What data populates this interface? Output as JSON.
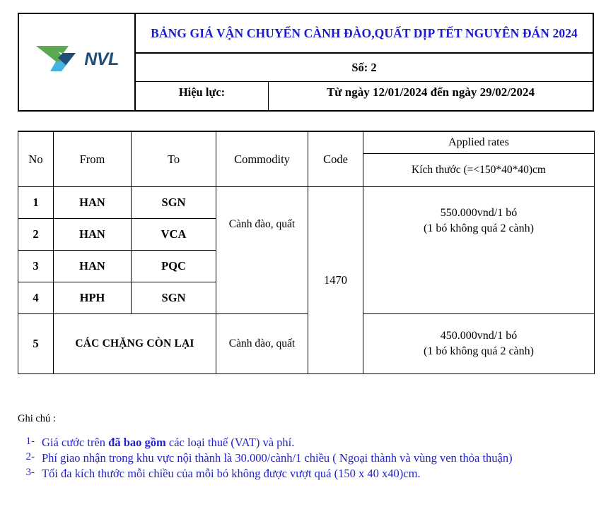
{
  "header": {
    "logo": {
      "icon": "nvl-bird-logo",
      "text": "NVL",
      "colors": {
        "wing_green": "#5aa84f",
        "wing_blue": "#45b3e0",
        "center_navy": "#1f4e79",
        "text": "#1f4e79"
      }
    },
    "title": "BẢNG GIÁ VẬN CHUYỂN CÀNH ĐÀO,QUẤT DỊP TẾT NGUYÊN ĐÁN 2024",
    "title_color": "#1a1ad2",
    "number_label": "Số: 2",
    "effective_label": "Hiệu lực:",
    "effective_value": "Từ ngày 12/01/2024  đến ngày 29/02/2024"
  },
  "table": {
    "columns": {
      "no": "No",
      "from": "From",
      "to": "To",
      "commodity": "Commodity",
      "code": "Code",
      "applied_rates": "Applied rates",
      "size": "Kích thước (=<150*40*40)cm"
    },
    "rows": [
      {
        "no": "1",
        "from": "HAN",
        "to": "SGN"
      },
      {
        "no": "2",
        "from": "HAN",
        "to": "VCA"
      },
      {
        "no": "3",
        "from": "HAN",
        "to": "PQC"
      },
      {
        "no": "4",
        "from": "HPH",
        "to": "SGN"
      }
    ],
    "group_1_4": {
      "commodity": "Cành đào, quất",
      "rate_line1": "550.000vnd/1 bó",
      "rate_line2": "(1 bó không quá 2 cành)"
    },
    "code_all": "1470",
    "row_5": {
      "no": "5",
      "route": "CÁC CHẶNG CÒN LẠI",
      "commodity": "Cành đào, quất",
      "rate_line1": "450.000vnd/1 bó",
      "rate_line2": "(1 bó không quá 2 cành)"
    }
  },
  "notes": {
    "title": "Ghi chú :",
    "color": "#2222c8",
    "items": [
      {
        "number": "1-",
        "prefix": "Giá cước trên ",
        "bold": "đã bao gồm",
        "suffix": " các loại thuế (VAT) và phí."
      },
      {
        "number": "2-",
        "prefix": "Phí giao nhận trong khu vực nội thành là 30.000/cành/1 chiều ( Ngoại thành và vùng ven thỏa thuận)",
        "bold": "",
        "suffix": ""
      },
      {
        "number": "3-",
        "prefix": "Tối đa kích thước mỗi chiều của mỗi bó không được vượt quá (150 x 40 x40)cm.",
        "bold": "",
        "suffix": ""
      }
    ]
  }
}
